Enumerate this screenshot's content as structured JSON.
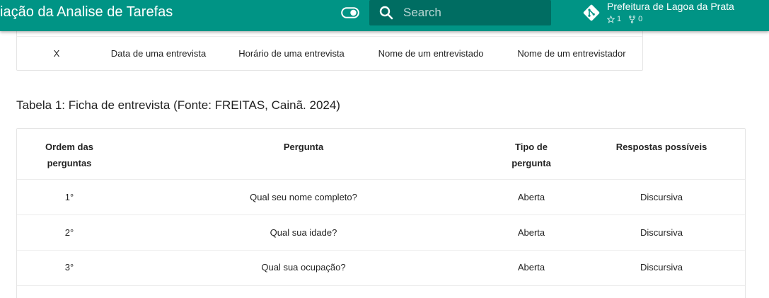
{
  "header": {
    "title": "iação da Analise de Tarefas",
    "search_placeholder": "Search",
    "repo": {
      "name": "Prefeitura de Lagoa da Prata",
      "stars": "1",
      "forks": "0"
    }
  },
  "table_top": {
    "cells": [
      "X",
      "Data de uma entrevista",
      "Horário de uma entrevista",
      "Nome de um entrevistado",
      "Nome de um entrevistador"
    ]
  },
  "caption": "Tabela 1: Ficha de entrevista (Fonte: FREITAS, Cainã. 2024)",
  "table_main": {
    "headers": [
      "Ordem das\nperguntas",
      "Pergunta",
      "Tipo de\npergunta",
      "Respostas possíveis"
    ],
    "rows": [
      {
        "order": "1°",
        "question": "Qual seu nome completo?",
        "type": "Aberta",
        "answers": "Discursiva"
      },
      {
        "order": "2°",
        "question": "Qual sua idade?",
        "type": "Aberta",
        "answers": "Discursiva"
      },
      {
        "order": "3°",
        "question": "Qual sua ocupação?",
        "type": "Aberta",
        "answers": "Discursiva"
      }
    ]
  },
  "colors": {
    "header_bg": "#009485",
    "text": "rgba(0,0,0,0.87)"
  }
}
